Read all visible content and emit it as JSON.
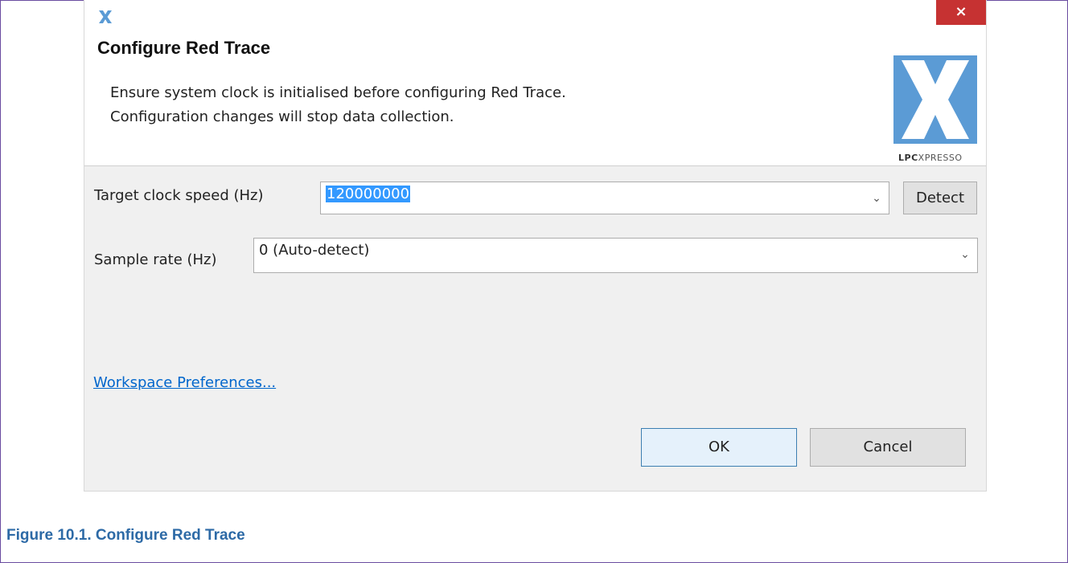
{
  "window": {
    "close_glyph": "×",
    "app_icon": "lpcxpresso-x-icon"
  },
  "header": {
    "title": "Configure Red Trace",
    "message_line1": "Ensure system clock is initialised before configuring Red Trace.",
    "message_line2": "Configuration changes will stop data collection.",
    "logo_icon": "lpcxpresso-logo",
    "logo_text_bold": "LPC",
    "logo_text_rest": "XPRESSO"
  },
  "form": {
    "clock_label": "Target clock speed (Hz)",
    "clock_value": "120000000",
    "detect_label": "Detect",
    "sample_label": "Sample rate (Hz)",
    "sample_value": "0 (Auto-detect)"
  },
  "links": {
    "workspace_preferences": "Workspace Preferences..."
  },
  "buttons": {
    "ok": "OK",
    "cancel": "Cancel"
  },
  "caption": "Figure 10.1. Configure Red Trace",
  "colors": {
    "accent_selection": "#3399ff",
    "close_button": "#c63232",
    "logo_blue": "#5b9bd5",
    "caption": "#2d6aa6"
  }
}
